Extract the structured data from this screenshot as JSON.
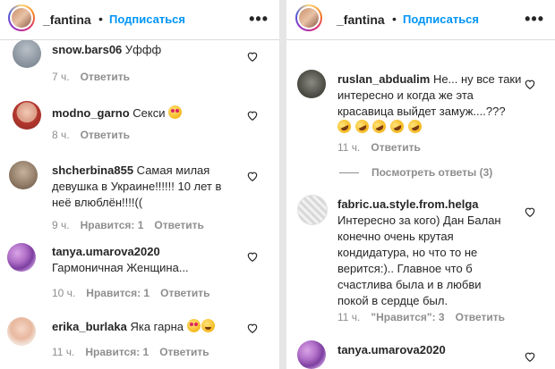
{
  "left": {
    "header": {
      "username": "_fantina",
      "dot": "•",
      "follow": "Подписаться",
      "more": "•••"
    },
    "comments": [
      {
        "user": "snow.bars06",
        "text": "Уффф",
        "time": "7 ч.",
        "reply": "Ответить"
      },
      {
        "user": "modno_garno",
        "text": "Секси",
        "time": "8 ч.",
        "reply": "Ответить"
      },
      {
        "user": "shcherbina855",
        "line1": "Самая милая",
        "line2": "девушка в Украине!!!!!! 10 лет в",
        "line3": "неё влюблён!!!!((",
        "time": "9 ч.",
        "likes": "Нравится: 1",
        "reply": "Ответить"
      },
      {
        "user": "tanya.umarova2020",
        "line2": "Гармоничная Женщина...",
        "time": "10 ч.",
        "likes": "Нравится: 1",
        "reply": "Ответить"
      },
      {
        "user": "erika_burlaka",
        "text": "Яка гарна",
        "time": "11 ч.",
        "likes": "Нравится: 1",
        "reply": "Ответить"
      }
    ]
  },
  "right": {
    "header": {
      "username": "_fantina",
      "dot": "•",
      "follow": "Подписаться",
      "more": "•••"
    },
    "comments": [
      {
        "user": "ruslan_abdualim",
        "line1": "Не... ну все таки",
        "line2": "интересно и когда же эта",
        "line3": "красавица выйдет замуж....???",
        "time": "11 ч.",
        "reply": "Ответить",
        "view_replies": "Посмотреть ответы (3)"
      },
      {
        "user": "fabric.ua.style.from.helga",
        "lines": [
          "Интересно за кого) Дан Балан",
          "конечно очень крутая",
          "кондидатура, но что то не",
          "верится:).. Главное что б",
          "счастлива была и в любви",
          "покой в сердце был."
        ],
        "time": "11 ч.",
        "likes": "\"Нравится\": 3",
        "reply": "Ответить"
      },
      {
        "user": "tanya.umarova2020"
      }
    ]
  }
}
